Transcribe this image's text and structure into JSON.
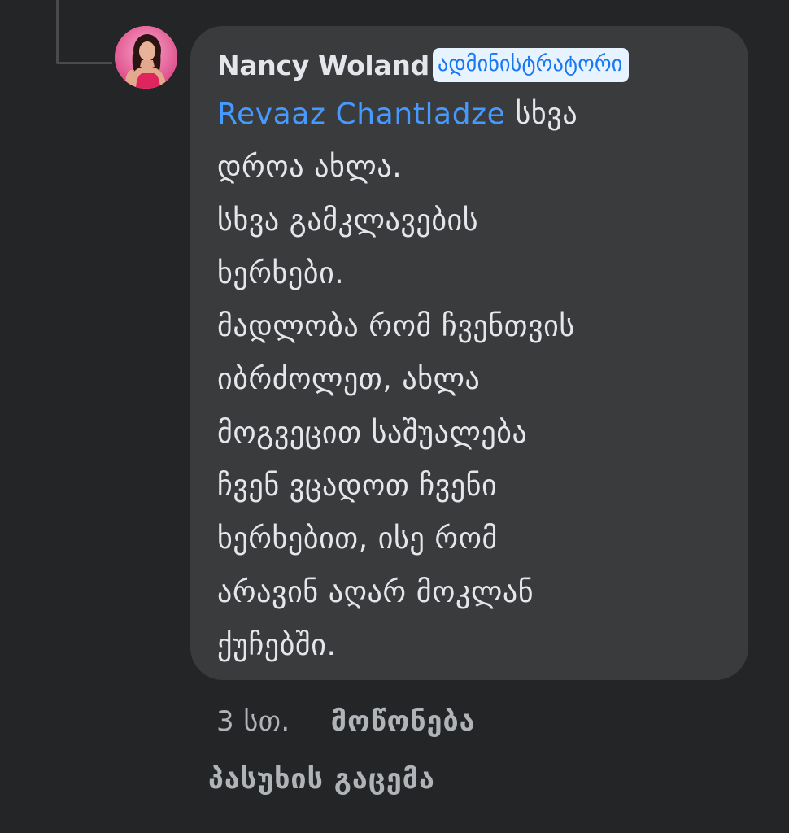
{
  "comment": {
    "author": "Nancy Woland",
    "badge": "ადმინისტრატორი",
    "mention": "Revaaz Chantladze",
    "text": " სხვა\nდროა ახლა.\nსხვა გამკლავების\nხერხები.\nმადლობა რომ ჩვენთვის\nიბრძოლეთ, ახლა\nმოგვეცით საშუალება\nჩვენ ვცადოთ ჩვენი\nხერხებით, ისე რომ\nარავინ აღარ მოკლან\nქუჩებში."
  },
  "actions": {
    "time": "3 სთ.",
    "like": "მოწონება",
    "reply": "პასუხის გაცემა"
  },
  "colors": {
    "background": "#242526",
    "bubble": "#3a3b3c",
    "text": "#e4e6eb",
    "mention": "#4599ff",
    "badge_bg": "#e7f3ff",
    "badge_text": "#1877f2",
    "secondary": "#b0b3b8"
  }
}
